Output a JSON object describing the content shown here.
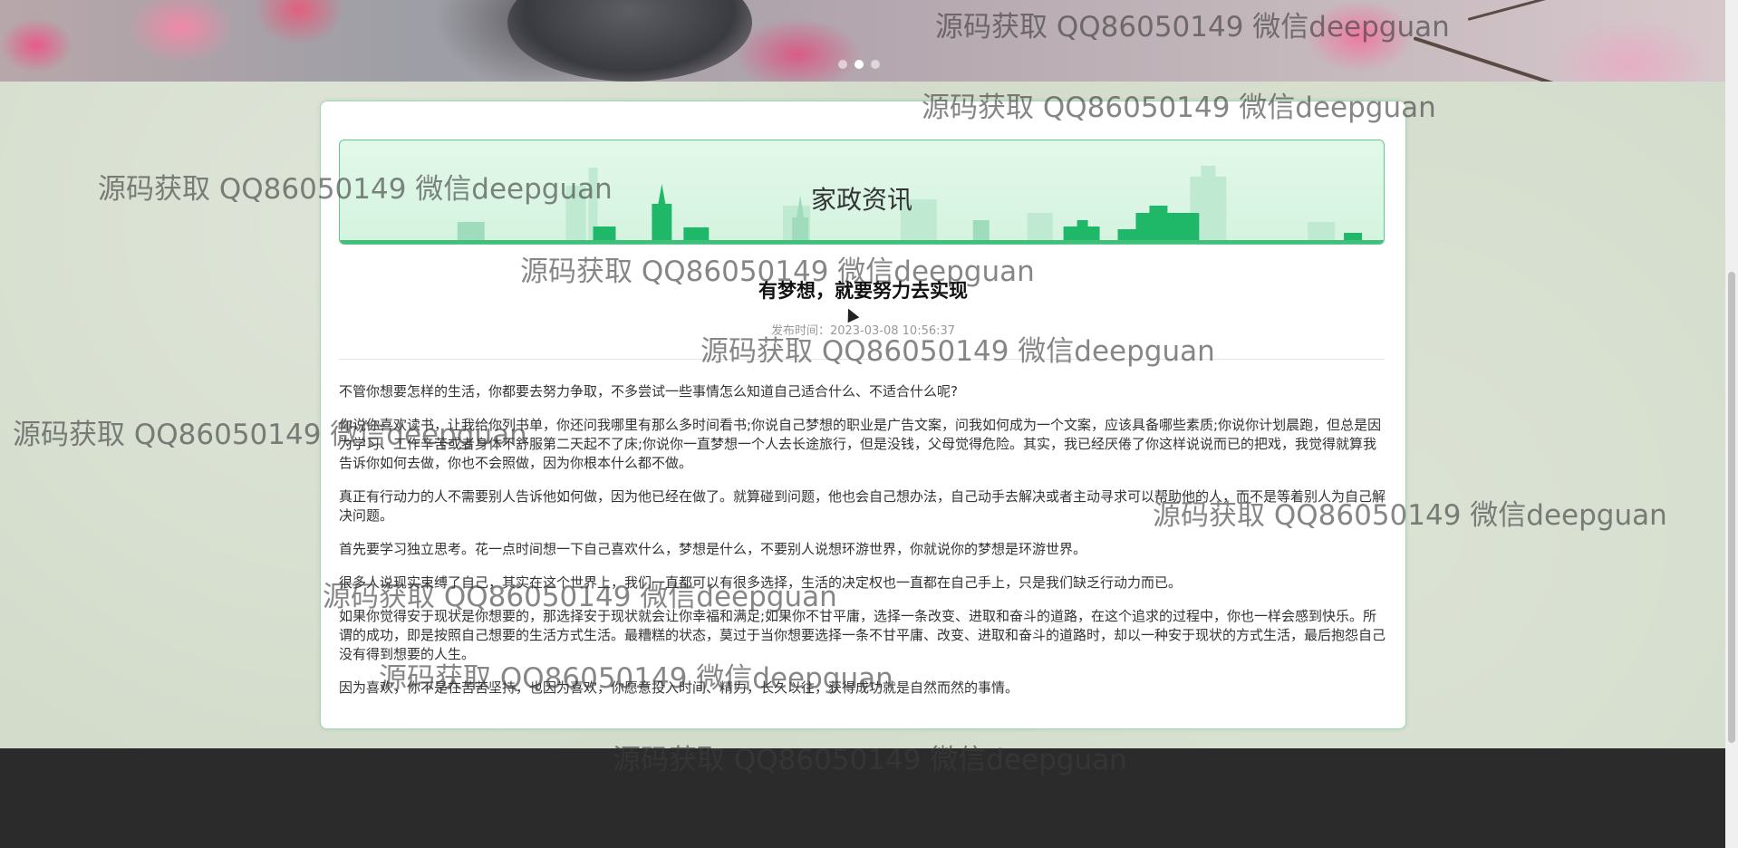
{
  "carousel": {
    "dot_count": 3,
    "active_index": 1
  },
  "section": {
    "title": "家政资讯"
  },
  "article": {
    "title": "有梦想，就要努力去实现",
    "publish_label": "发布时间：",
    "publish_time": "2023-03-08 10:56:37",
    "paragraphs": [
      "不管你想要怎样的生活，你都要去努力争取，不多尝试一些事情怎么知道自己适合什么、不适合什么呢?",
      "你说你喜欢读书，让我给你列书单，你还问我哪里有那么多时间看书;你说自己梦想的职业是广告文案，问我如何成为一个文案，应该具备哪些素质;你说你计划晨跑，但总是因为学习、工作辛苦或者身体不舒服第二天起不了床;你说你一直梦想一个人去长途旅行，但是没钱，父母觉得危险。其实，我已经厌倦了你这样说说而已的把戏，我觉得就算我告诉你如何去做，你也不会照做，因为你根本什么都不做。",
      "真正有行动力的人不需要别人告诉他如何做，因为他已经在做了。就算碰到问题，他也会自己想办法，自己动手去解决或者主动寻求可以帮助他的人，而不是等着别人为自己解决问题。",
      "首先要学习独立思考。花一点时间想一下自己喜欢什么，梦想是什么，不要别人说想环游世界，你就说你的梦想是环游世界。",
      "很多人说现实束缚了自己，其实在这个世界上，我们一直都可以有很多选择，生活的决定权也一直都在自己手上，只是我们缺乏行动力而已。",
      "如果你觉得安于现状是你想要的，那选择安于现状就会让你幸福和满足;如果你不甘平庸，选择一条改变、进取和奋斗的道路，在这个追求的过程中，你也一样会感到快乐。所谓的成功，即是按照自己想要的生活方式生活。最糟糕的状态，莫过于当你想要选择一条不甘平庸、改变、进取和奋斗的道路时，却以一种安于现状的方式生活，最后抱怨自己没有得到想要的人生。",
      "因为喜欢，你不是在苦苦坚持，也因为喜欢，你愿意投入时间、精力，长久以往，获得成功就是自然而然的事情。"
    ]
  },
  "watermark": {
    "text": "源码获取 QQ86050149 微信deepguan"
  },
  "colors": {
    "accent_green": "#3ec07a",
    "header_bg": "#d9f5e3",
    "footer_bg": "#2b2b2b"
  }
}
